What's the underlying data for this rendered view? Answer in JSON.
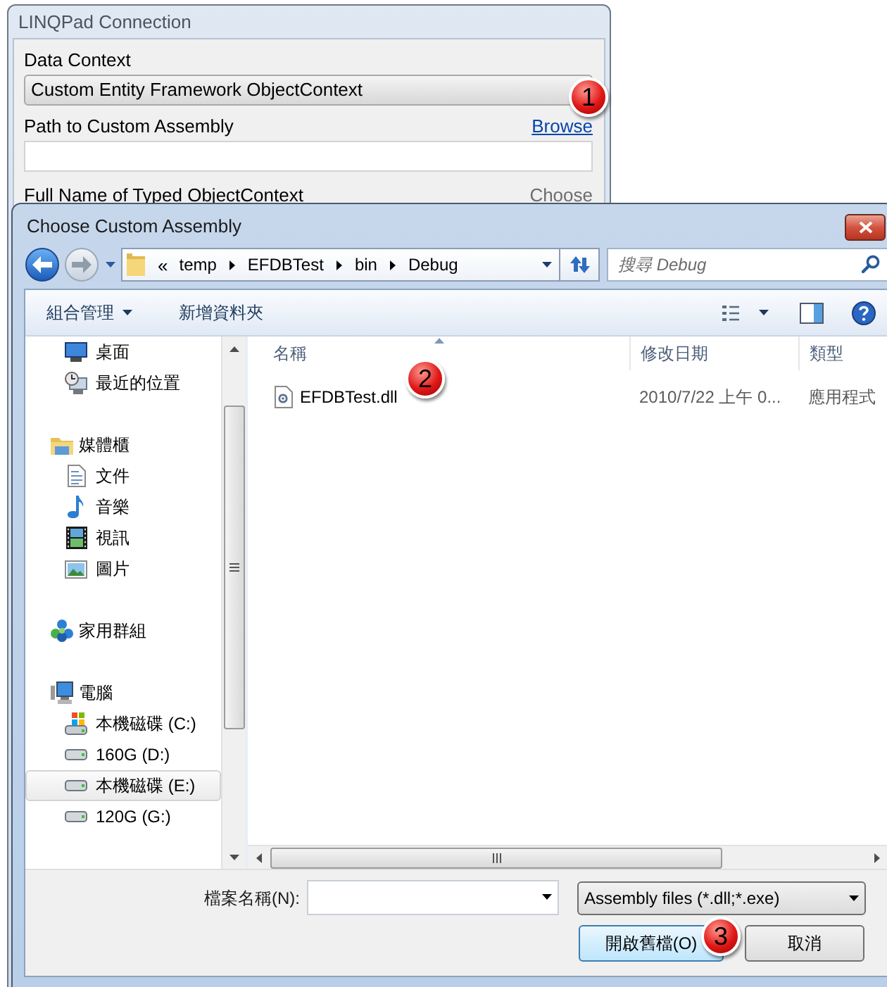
{
  "connection_window": {
    "title": "LINQPad Connection",
    "data_context": {
      "label": "Data Context",
      "value": "Custom Entity Framework ObjectContext",
      "callout": "1"
    },
    "assembly_path": {
      "label": "Path to Custom Assembly",
      "link": "Browse",
      "link_disabled": false
    },
    "typed_context": {
      "label": "Full Name of Typed ObjectContext",
      "link": "Choose",
      "link_disabled": true
    }
  },
  "dialog": {
    "title": "Choose Custom Assembly",
    "history": [
      {
        "kind": "back",
        "disabled": false
      },
      {
        "kind": "forward",
        "disabled": true
      }
    ],
    "address_bar": {
      "overflow": "«",
      "path": [
        "temp",
        "EFDBTest",
        "bin",
        "Debug"
      ]
    },
    "search": {
      "placeholder": "搜尋 Debug"
    },
    "toolbar": [
      {
        "label": "組合管理",
        "menu": true
      },
      {
        "label": "新增資料夾",
        "menu": false
      }
    ],
    "navigation": [
      {
        "children": [
          {
            "label": "桌面",
            "kind": "desktop",
            "selected": false
          },
          {
            "label": "最近的位置",
            "kind": "recent",
            "selected": false
          }
        ]
      },
      {
        "label": "媒體櫃",
        "kind": "library",
        "selected": false,
        "children": [
          {
            "label": "文件",
            "kind": "documents",
            "selected": false
          },
          {
            "label": "音樂",
            "kind": "music",
            "selected": false
          },
          {
            "label": "視訊",
            "kind": "videos",
            "selected": false
          },
          {
            "label": "圖片",
            "kind": "pictures",
            "selected": false
          }
        ]
      },
      {
        "label": "家用群組",
        "kind": "homegroup",
        "selected": false
      },
      {
        "label": "電腦",
        "kind": "computer",
        "selected": false,
        "children": [
          {
            "label": "本機磁碟 (C:)",
            "kind": "system_drive",
            "selected": false
          },
          {
            "label": "160G (D:)",
            "kind": "drive",
            "selected": false
          },
          {
            "label": "本機磁碟 (E:)",
            "kind": "drive",
            "selected": true
          },
          {
            "label": "120G (G:)",
            "kind": "drive",
            "selected": false
          }
        ]
      }
    ],
    "file_list": {
      "columns": [
        {
          "label": "名稱",
          "sorted": true
        },
        {
          "label": "修改日期",
          "sorted": false
        },
        {
          "label": "類型",
          "sorted": false
        }
      ],
      "rows": [
        {
          "cells": [
            "EFDBTest.dll",
            "2010/7/22 上午 0...",
            "應用程式"
          ],
          "selected": false,
          "callout": "2"
        }
      ]
    },
    "file_name": {
      "label": "檔案名稱(N):"
    },
    "file_type": {
      "value": "Assembly files (*.dll;*.exe)"
    },
    "buttons": [
      {
        "label": "開啟舊檔(O)",
        "default": true,
        "callout": "3"
      },
      {
        "label": "取消",
        "default": false
      }
    ]
  }
}
